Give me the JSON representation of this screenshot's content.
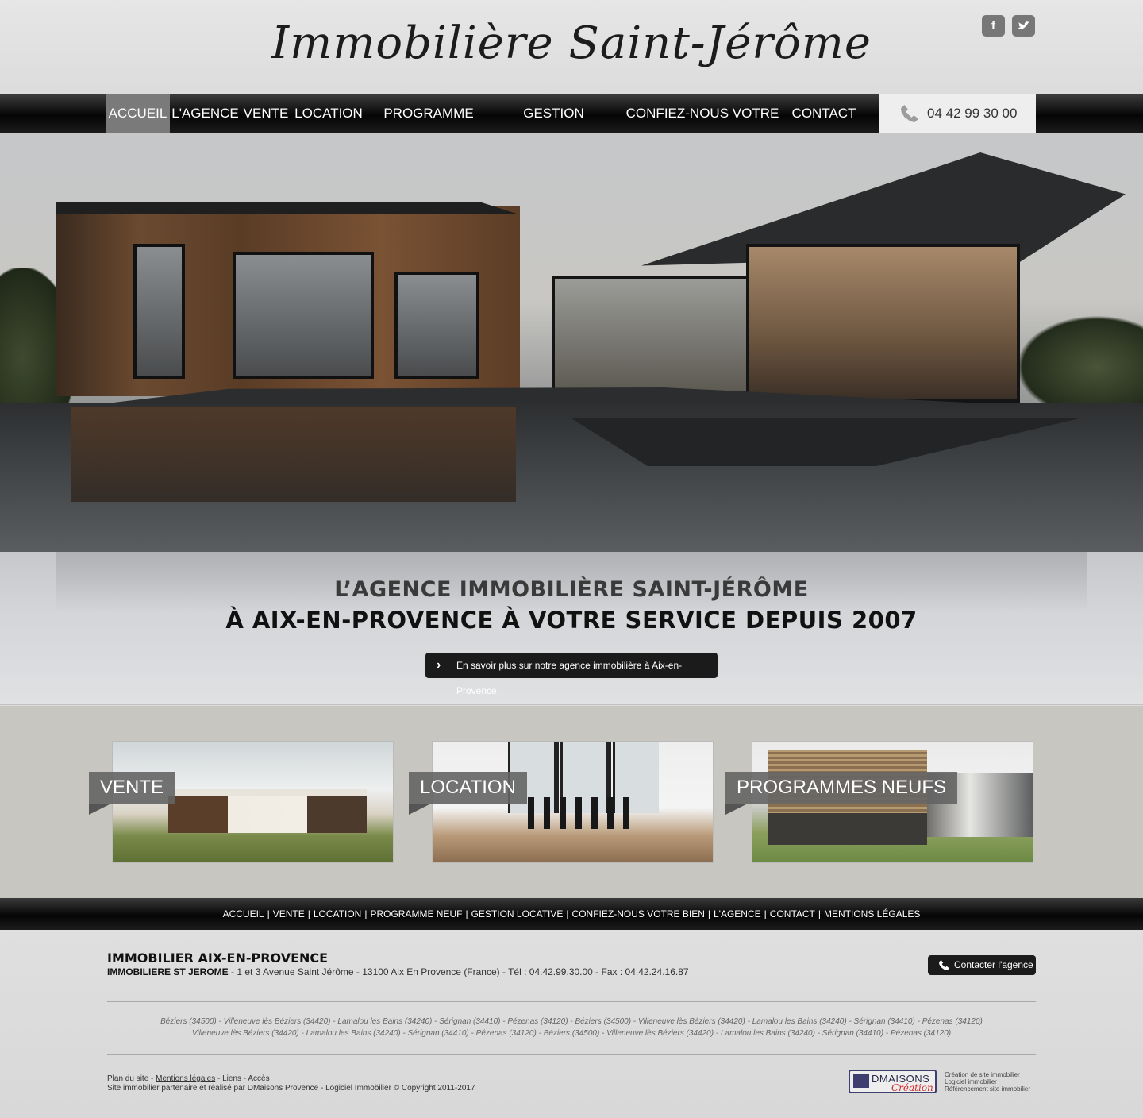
{
  "header": {
    "logo": "Immobilière Saint-Jérôme",
    "social": [
      {
        "icon": "facebook-icon",
        "label": "f"
      },
      {
        "icon": "twitter-icon",
        "label": ""
      }
    ]
  },
  "nav": {
    "items": [
      "ACCUEIL",
      "L'AGENCE",
      "VENTE",
      "LOCATION",
      "PROGRAMME NEUF",
      "GESTION LOCATIVE",
      "CONFIEZ-NOUS VOTRE BIEN",
      "CONTACT"
    ],
    "active": "ACCUEIL",
    "phone": "04 42 99 30 00"
  },
  "banner": {
    "line1": "L’AGENCE IMMOBILIÈRE SAINT-JÉRÔME",
    "line2": "À AIX-EN-PROVENCE À VOTRE SERVICE DEPUIS 2007",
    "cta": "En savoir plus sur notre agence immobilière à Aix-en-Provence"
  },
  "cards": [
    {
      "label": "VENTE"
    },
    {
      "label": "LOCATION"
    },
    {
      "label": "PROGRAMMES NEUFS"
    }
  ],
  "footer_nav": [
    "ACCUEIL",
    "VENTE",
    "LOCATION",
    "PROGRAMME NEUF",
    "GESTION LOCATIVE",
    "CONFIEZ-NOUS VOTRE BIEN",
    "L'AGENCE",
    "CONTACT",
    "MENTIONS LÉGALES"
  ],
  "footer": {
    "title": "IMMOBILIER AIX-EN-PROVENCE",
    "agency_name": "IMMOBILIERE ST JEROME",
    "address": " - 1 et 3 Avenue Saint Jérôme - 13100 Aix En Provence (France) - Tél : 04.42.99.30.00 - Fax : 04.42.24.16.87",
    "contact_button": "Contacter l'agence",
    "seo_line1": "Béziers (34500) - Villeneuve lès Béziers (34420) - Lamalou les Bains (34240) - Sérignan (34410) - Pézenas (34120) - Béziers (34500) - Villeneuve lès Béziers (34420) - Lamalou les Bains (34240) - Sérignan (34410) - Pézenas (34120)",
    "seo_line2": "Villeneuve lès Béziers (34420) - Lamalou les Bains (34240) - Sérignan (34410) - Pézenas (34120) - Béziers (34500) - Villeneuve lès Béziers (34420) - Lamalou les Bains (34240) - Sérignan (34410) - Pézenas (34120)",
    "links": {
      "plan": "Plan du site",
      "mentions": "Mentions légales",
      "liens": "Liens",
      "acces": "Accès"
    },
    "copyright": "Site immobilier partenaire et réalisé par DMaisons Provence - Logiciel Immobilier © Copyright 2011-2017",
    "dm_logo": {
      "name": "DMAISONS",
      "sub": "Création"
    },
    "dm_text": [
      "Création de site immobilier",
      "Logiciel immobilier",
      "Référencement site immobilier"
    ]
  }
}
